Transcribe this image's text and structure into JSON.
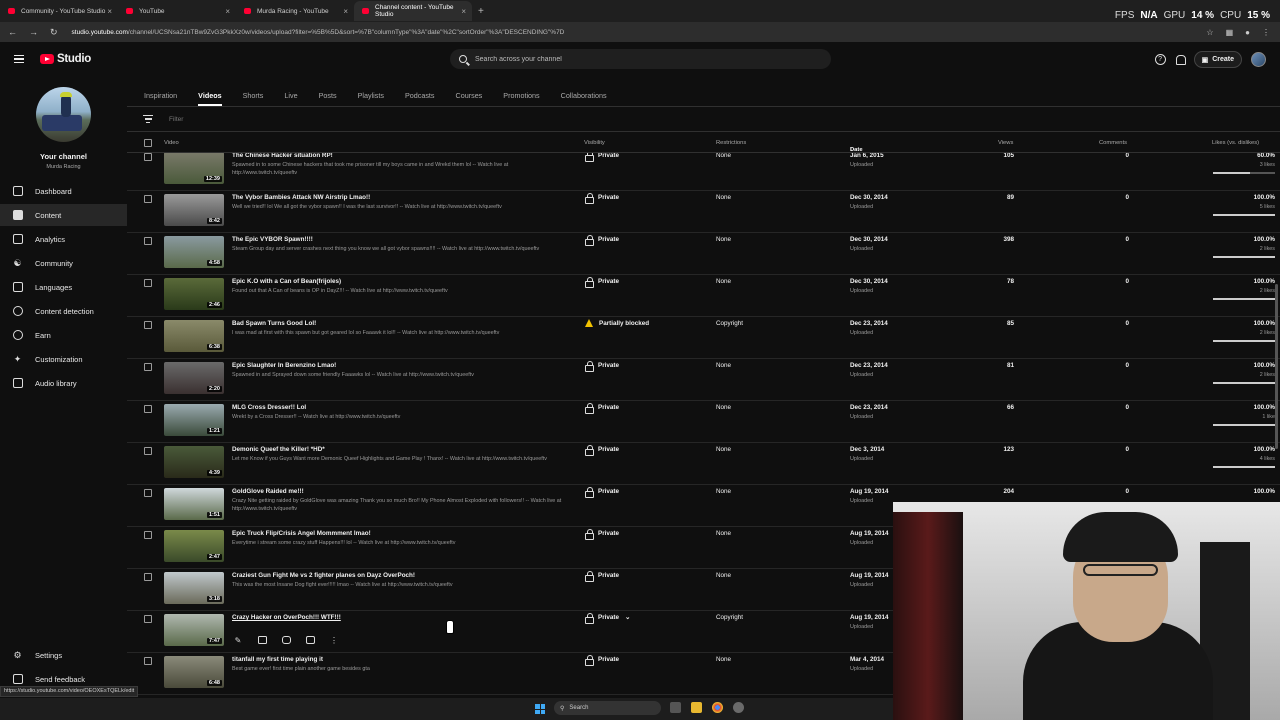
{
  "browser": {
    "tabs": [
      {
        "label": "Community - YouTube Studio",
        "active": false
      },
      {
        "label": "YouTube",
        "active": false
      },
      {
        "label": "Murda Racing - YouTube",
        "active": false
      },
      {
        "label": "Channel content - YouTube Studio",
        "active": true
      }
    ],
    "new_tab": "+",
    "url_host": "studio.youtube.com",
    "url_path": "/channel/UCSNsa21nTBw9ZvG3PkkXz0w/videos/upload?filter=%5B%5D&sort=%7B\"columnType\"%3A\"date\"%2C\"sortOrder\"%3A\"DESCENDING\"%7D",
    "status_url": "https://studio.youtube.com/video/OEOXEsTQELk/edit"
  },
  "overlay": {
    "fps_label": "FPS",
    "fps_value": "N/A",
    "gpu_label": "GPU",
    "gpu_value": "14 %",
    "cpu_label": "CPU",
    "cpu_value": "15 %"
  },
  "header": {
    "logo_text": "Studio",
    "search_placeholder": "Search across your channel",
    "create_label": "Create"
  },
  "sidebar": {
    "channel_title": "Your channel",
    "channel_name": "Murda Racing",
    "items": [
      {
        "label": "Dashboard",
        "icon": "dashboard-icon",
        "active": false
      },
      {
        "label": "Content",
        "icon": "content-icon",
        "active": true
      },
      {
        "label": "Analytics",
        "icon": "analytics-icon",
        "active": false
      },
      {
        "label": "Community",
        "icon": "community-icon",
        "active": false
      },
      {
        "label": "Languages",
        "icon": "languages-icon",
        "active": false
      },
      {
        "label": "Content detection",
        "icon": "content-detection-icon",
        "active": false
      },
      {
        "label": "Earn",
        "icon": "earn-icon",
        "active": false
      },
      {
        "label": "Customization",
        "icon": "customization-icon",
        "active": false
      },
      {
        "label": "Audio library",
        "icon": "audio-library-icon",
        "active": false
      }
    ],
    "settings_label": "Settings",
    "feedback_label": "Send feedback"
  },
  "tabs": [
    "Inspiration",
    "Videos",
    "Shorts",
    "Live",
    "Posts",
    "Playlists",
    "Podcasts",
    "Courses",
    "Promotions",
    "Collaborations"
  ],
  "active_tab": "Videos",
  "filter_placeholder": "Filter",
  "columns": {
    "video": "Video",
    "visibility": "Visibility",
    "restrictions": "Restrictions",
    "date": "Date",
    "views": "Views",
    "comments": "Comments",
    "likes": "Likes (vs. dislikes)"
  },
  "videos": [
    {
      "title": "The Chinese Hacker situation RP!",
      "desc": "Spawned in to some Chinese hackers that took me prisoner till my boys came in and Wrekd them lol -- Watch live at http://www.twitch.tv/queeftv",
      "duration": "12:39",
      "visibility": "Private",
      "restrictions": "None",
      "date": "Jan 6, 2015",
      "status": "Uploaded",
      "views": "105",
      "comments": "0",
      "likes": "60.0%",
      "like_count": "3 likes",
      "like_ratio": 0.6,
      "thumb": [
        "#7a7a6a",
        "#4a5a3a"
      ]
    },
    {
      "title": "The Vybor Bambies Attack NW Airstrip Lmao!!",
      "desc": "Well we tried!! lol We all got the vybor spawn!! I was the last survivor!! -- Watch live at http://www.twitch.tv/queeftv",
      "duration": "8:42",
      "visibility": "Private",
      "restrictions": "None",
      "date": "Dec 30, 2014",
      "status": "Uploaded",
      "views": "89",
      "comments": "0",
      "likes": "100.0%",
      "like_count": "5 likes",
      "like_ratio": 1.0,
      "thumb": [
        "#9a9a9a",
        "#4a4a4a"
      ]
    },
    {
      "title": "The Epic VYBOR Spawn!!!!",
      "desc": "Steam Group day and server crashes next thing you know we all got vybor spawns!!!! -- Watch live at http://www.twitch.tv/queeftv",
      "duration": "4:58",
      "visibility": "Private",
      "restrictions": "None",
      "date": "Dec 30, 2014",
      "status": "Uploaded",
      "views": "398",
      "comments": "0",
      "likes": "100.0%",
      "like_count": "2 likes",
      "like_ratio": 1.0,
      "thumb": [
        "#8a9aa0",
        "#5a6a4a"
      ]
    },
    {
      "title": "Epic K.O with a Can of Bean(frijoles)",
      "desc": "Found out that A Can of beans is OP in DayZ!!! -- Watch live at http://www.twitch.tv/queeftv",
      "duration": "2:46",
      "visibility": "Private",
      "restrictions": "None",
      "date": "Dec 30, 2014",
      "status": "Uploaded",
      "views": "78",
      "comments": "0",
      "likes": "100.0%",
      "like_count": "2 likes",
      "like_ratio": 1.0,
      "thumb": [
        "#5a6a3a",
        "#2a3a1a"
      ]
    },
    {
      "title": "Bad Spawn Turns Good Lol!",
      "desc": "I was mad at first with this spawn but got geared lol so Faaawk it lol!! -- Watch live at http://www.twitch.tv/queeftv",
      "duration": "6:38",
      "visibility": "Partially blocked",
      "visibility_icon": "warning-icon",
      "restrictions": "Copyright",
      "date": "Dec 23, 2014",
      "status": "Uploaded",
      "views": "85",
      "comments": "0",
      "likes": "100.0%",
      "like_count": "2 likes",
      "like_ratio": 1.0,
      "thumb": [
        "#8a8a6a",
        "#5a5a3a"
      ]
    },
    {
      "title": "Epic Slaughter In Berenzino Lmao!",
      "desc": "Spawned in and Sprayed down some friendly Faaawks lol -- Watch live at http://www.twitch.tv/queeftv",
      "duration": "2:20",
      "visibility": "Private",
      "restrictions": "None",
      "date": "Dec 23, 2014",
      "status": "Uploaded",
      "views": "81",
      "comments": "0",
      "likes": "100.0%",
      "like_count": "2 likes",
      "like_ratio": 1.0,
      "thumb": [
        "#6a6a6a",
        "#3a3030"
      ]
    },
    {
      "title": "MLG Cross Dresser!! Lol",
      "desc": "Wrekt by a Cross Dresser!! -- Watch live at http://www.twitch.tv/queeftv",
      "duration": "1:21",
      "visibility": "Private",
      "restrictions": "None",
      "date": "Dec 23, 2014",
      "status": "Uploaded",
      "views": "66",
      "comments": "0",
      "likes": "100.0%",
      "like_count": "1 like",
      "like_ratio": 1.0,
      "thumb": [
        "#9aaab0",
        "#3a4a3a"
      ]
    },
    {
      "title": "Demonic Queef the Killer! *HD*",
      "desc": "Let me Know if you Guys Want more Demonic Queef Highlights and Game Play ! Thanx! -- Watch live at http://www.twitch.tv/queeftv",
      "duration": "4:39",
      "visibility": "Private",
      "restrictions": "None",
      "date": "Dec 3, 2014",
      "status": "Uploaded",
      "views": "123",
      "comments": "0",
      "likes": "100.0%",
      "like_count": "4 likes",
      "like_ratio": 1.0,
      "thumb": [
        "#4a5a3a",
        "#2a2a1a"
      ]
    },
    {
      "title": "GoldGlove Raided me!!!",
      "desc": "Crazy Nite getting raided by GoldGlove was amazing Thank you so much Bro!! My Phone Almost Exploded with followers!! -- Watch live at http://www.twitch.tv/queeftv",
      "duration": "1:51",
      "visibility": "Private",
      "restrictions": "None",
      "date": "Aug 19, 2014",
      "status": "Uploaded",
      "views": "204",
      "comments": "0",
      "likes": "100.0%",
      "like_count": "",
      "like_ratio": 1.0,
      "thumb": [
        "#d0d8dc",
        "#5a6a4a"
      ]
    },
    {
      "title": "Epic Truck Flip/Crisis Angel Mommment lmao!",
      "desc": "Everytime i stream some crazy stuff Happens!!! lol -- Watch live at http://www.twitch.tv/queeftv",
      "duration": "2:47",
      "visibility": "Private",
      "restrictions": "None",
      "date": "Aug 19, 2014",
      "status": "Uploaded",
      "views": "",
      "comments": "",
      "likes": "",
      "like_count": "",
      "like_ratio": 0,
      "thumb": [
        "#7a8a4a",
        "#3a4a2a"
      ]
    },
    {
      "title": "Craziest Gun Fight Me vs 2 fighter planes on Dayz OverPoch!",
      "desc": "This was the most Insane Dog fight ever!!!!! lmao -- Watch live at http://www.twitch.tv/queeftv",
      "duration": "3:18",
      "visibility": "Private",
      "restrictions": "None",
      "date": "Aug 19, 2014",
      "status": "Uploaded",
      "views": "",
      "comments": "",
      "likes": "",
      "like_count": "",
      "like_ratio": 0,
      "thumb": [
        "#c0c8cc",
        "#6a6a5a"
      ]
    },
    {
      "title": "Crazy Hacker on OverPoch!!! WTF!!!",
      "desc": "",
      "duration": "7:47",
      "visibility": "Private",
      "restrictions": "Copyright",
      "date": "Aug 19, 2014",
      "status": "Uploaded",
      "views": "",
      "comments": "",
      "likes": "",
      "like_count": "",
      "like_ratio": 0,
      "thumb": [
        "#b0b8b0",
        "#5a6a4a"
      ],
      "hovered": true
    },
    {
      "title": "titanfall my first time playing it",
      "desc": "Best game ever! first time plain another game besides gta",
      "duration": "6:48",
      "visibility": "Private",
      "restrictions": "None",
      "date": "Mar 4, 2014",
      "status": "Uploaded",
      "views": "",
      "comments": "",
      "likes": "",
      "like_count": "",
      "like_ratio": 0,
      "thumb": [
        "#8a8a7a",
        "#4a4a3a"
      ]
    }
  ],
  "taskbar": {
    "search_label": "Search"
  }
}
